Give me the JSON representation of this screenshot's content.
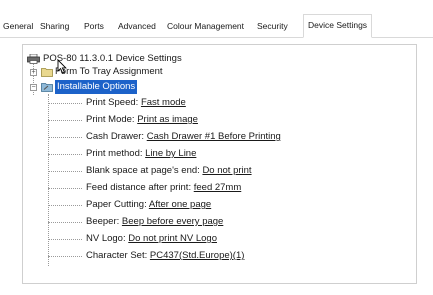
{
  "tabs": [
    {
      "label": "General"
    },
    {
      "label": "Sharing"
    },
    {
      "label": "Ports"
    },
    {
      "label": "Advanced"
    },
    {
      "label": "Colour Management"
    },
    {
      "label": "Security"
    },
    {
      "label": "Device Settings"
    }
  ],
  "active_tab": "Device Settings",
  "tree": {
    "root": "POS-80 11.3.0.1 Device Settings",
    "form_assign": "Form To Tray Assignment",
    "installable": "Installable Options",
    "options": [
      {
        "label": "Print Speed:",
        "value": "Fast mode"
      },
      {
        "label": "Print Mode:",
        "value": "Print as image"
      },
      {
        "label": "Cash Drawer:",
        "value": "Cash Drawer #1 Before Printing"
      },
      {
        "label": "Print method:",
        "value": "Line by Line"
      },
      {
        "label": "Blank space at page's end:",
        "value": "Do not print"
      },
      {
        "label": "Feed distance after print:",
        "value": "feed 27mm"
      },
      {
        "label": "Paper Cutting:",
        "value": "After one page"
      },
      {
        "label": "Beeper:",
        "value": "Beep before every page"
      },
      {
        "label": "NV Logo:",
        "value": "Do not print NV Logo"
      },
      {
        "label": "Character Set:",
        "value": "PC437(Std.Europe)(1)"
      }
    ]
  },
  "colors": {
    "selection": "#1c62c9",
    "border": "#cfcfcf"
  },
  "icons": [
    "printer-icon",
    "folder-icon",
    "wrench-folder-icon",
    "mouse-cursor-icon"
  ]
}
